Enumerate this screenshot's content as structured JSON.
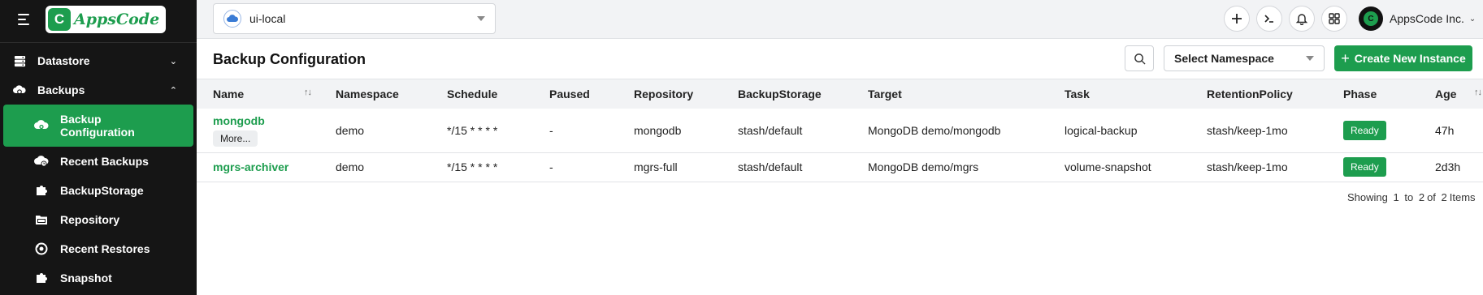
{
  "sidebar": {
    "logo_text": "AppsCode",
    "groups": [
      {
        "label": "Datastore",
        "icon": "database-icon",
        "expanded": false
      },
      {
        "label": "Backups",
        "icon": "backup-icon",
        "expanded": true
      }
    ],
    "items": [
      {
        "label": "Backup Configuration",
        "icon": "backup-config-icon",
        "active": true
      },
      {
        "label": "Recent Backups",
        "icon": "recent-backups-icon"
      },
      {
        "label": "BackupStorage",
        "icon": "puzzle-icon"
      },
      {
        "label": "Repository",
        "icon": "folder-icon"
      },
      {
        "label": "Recent Restores",
        "icon": "restore-icon"
      },
      {
        "label": "Snapshot",
        "icon": "puzzle-icon"
      }
    ]
  },
  "topbar": {
    "cluster": "ui-local",
    "account": "AppsCode Inc.",
    "buttons": [
      "plus-icon",
      "terminal-icon",
      "bell-icon",
      "grid-icon"
    ]
  },
  "page": {
    "title": "Backup Configuration",
    "namespace_placeholder": "Select Namespace",
    "create_label": "Create New Instance"
  },
  "table": {
    "columns": [
      "Name",
      "Namespace",
      "Schedule",
      "Paused",
      "Repository",
      "BackupStorage",
      "Target",
      "Task",
      "RetentionPolicy",
      "Phase",
      "Age"
    ],
    "rows": [
      {
        "name": "mongodb",
        "more": "More...",
        "namespace": "demo",
        "schedule": "*/15 * * * *",
        "paused": "-",
        "repository": "mongodb",
        "backupstorage": "stash/default",
        "target": "MongoDB demo/mongodb",
        "task": "logical-backup",
        "retention": "stash/keep-1mo",
        "phase": "Ready",
        "age": "47h"
      },
      {
        "name": "mgrs-archiver",
        "namespace": "demo",
        "schedule": "*/15 * * * *",
        "paused": "-",
        "repository": "mgrs-full",
        "backupstorage": "stash/default",
        "target": "MongoDB demo/mgrs",
        "task": "volume-snapshot",
        "retention": "stash/keep-1mo",
        "phase": "Ready",
        "age": "2d3h"
      }
    ]
  },
  "pagination": {
    "showing": "Showing",
    "from": "1",
    "to_word": "to",
    "to": "2",
    "of_word": "of",
    "total": "2",
    "items_word": "Items"
  },
  "colors": {
    "accent": "#1d9d4e",
    "sidebar_bg": "#151515",
    "topbar_bg": "#f2f3f5"
  }
}
